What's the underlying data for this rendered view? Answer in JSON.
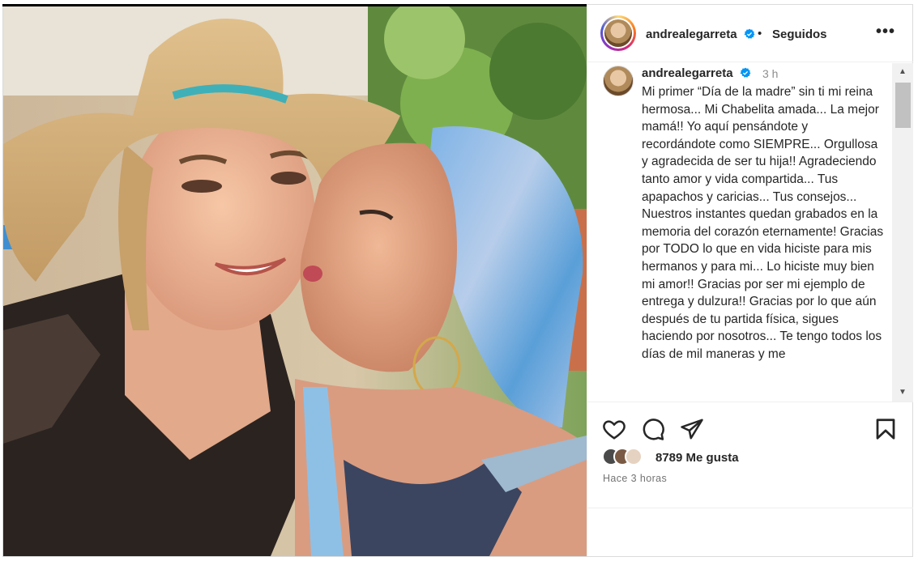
{
  "post": {
    "username": "andrealegarreta",
    "follow_separator": "•",
    "follow_status": "Seguidos",
    "more_label": "•••",
    "caption_username": "andrealegarreta",
    "caption_time": "3 h",
    "caption_text": "Mi primer “Día de la madre” sin ti mi reina hermosa... Mi Chabelita amada... La mejor mamá!! Yo aquí pensándote y recordándote como SIEMPRE... Orgullosa y agradecida de ser tu hija!! Agradeciendo tanto amor y vida compartida... Tus apapachos y caricias... Tus consejos... Nuestros instantes quedan grabados en la memoria del corazón eternamente! Gracias por TODO lo que en vida hiciste para mis hermanos y para mi... Lo hiciste muy bien mi amor!! Gracias por ser mi ejemplo de entrega y dulzura!! Gracias por lo que aún después de tu partida física, sigues haciendo por nosotros... Te tengo todos los días de mil maneras y me",
    "likes_count": "8789",
    "likes_label": "Me gusta",
    "posted_ago": "Hace 3 horas"
  },
  "icons": {
    "verified": "verified-badge-icon",
    "like": "heart-icon",
    "comment": "comment-bubble-icon",
    "share": "paper-plane-icon",
    "save": "bookmark-icon",
    "more": "more-dots-icon"
  },
  "colors": {
    "verified_blue": "#0095f6",
    "text": "#262626",
    "muted": "#737373",
    "border": "#dbdbdb"
  }
}
